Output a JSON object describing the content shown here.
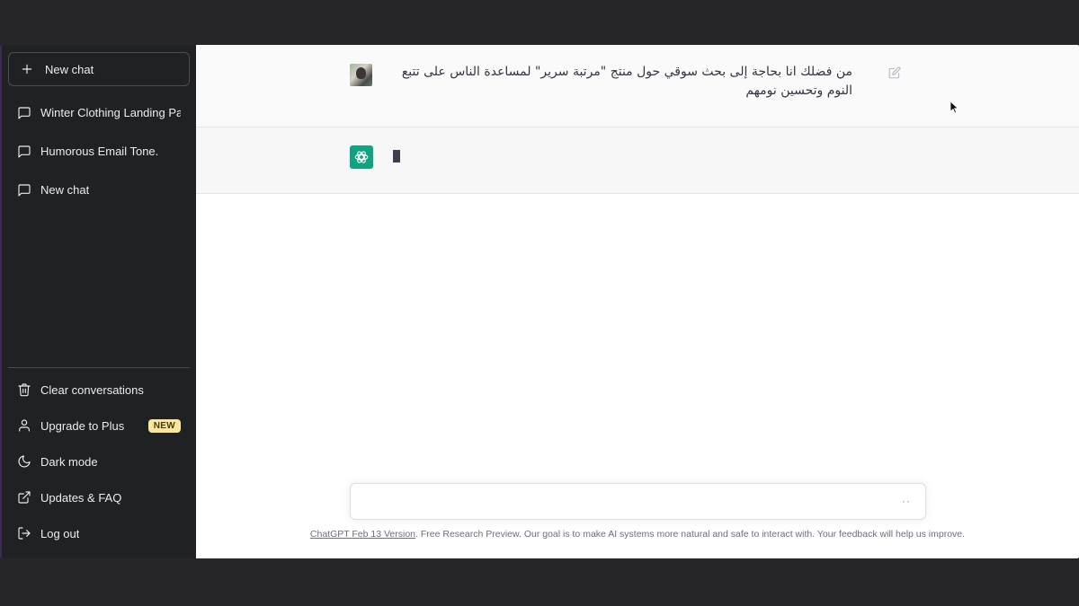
{
  "sidebar": {
    "new_chat": {
      "label": "New chat",
      "icon": "plus-icon"
    },
    "history": [
      {
        "label": "Winter Clothing Landing Page",
        "icon": "message-icon"
      },
      {
        "label": "Humorous Email Tone.",
        "icon": "message-icon"
      },
      {
        "label": "New chat",
        "icon": "message-icon"
      }
    ],
    "bottom": [
      {
        "label": "Clear conversations",
        "icon": "trash-icon"
      },
      {
        "label": "Upgrade to Plus",
        "icon": "user-icon",
        "badge": "NEW"
      },
      {
        "label": "Dark mode",
        "icon": "moon-icon"
      },
      {
        "label": "Updates & FAQ",
        "icon": "external-link-icon"
      },
      {
        "label": "Log out",
        "icon": "logout-icon"
      }
    ]
  },
  "conversation": {
    "user_message": "من فضلك انا بحاجة إلى بحث سوقي حول منتج \"مرتبة سرير\" لمساعدة الناس على تتبع النوم وتحسين نومهم",
    "assistant_message": ""
  },
  "composer": {
    "value": "",
    "placeholder": "",
    "status_indicator": "··"
  },
  "footer": {
    "version_link": "ChatGPT Feb 13 Version",
    "note": ". Free Research Preview. Our goal is to make AI systems more natural and safe to interact with. Your feedback will help us improve."
  },
  "colors": {
    "sidebar_bg": "#202123",
    "main_bg": "#ffffff",
    "assistant_bg": "#f7f7f8",
    "brand_green": "#10a37f",
    "badge_bg": "#fae69e",
    "outer_bg": "#262629"
  }
}
